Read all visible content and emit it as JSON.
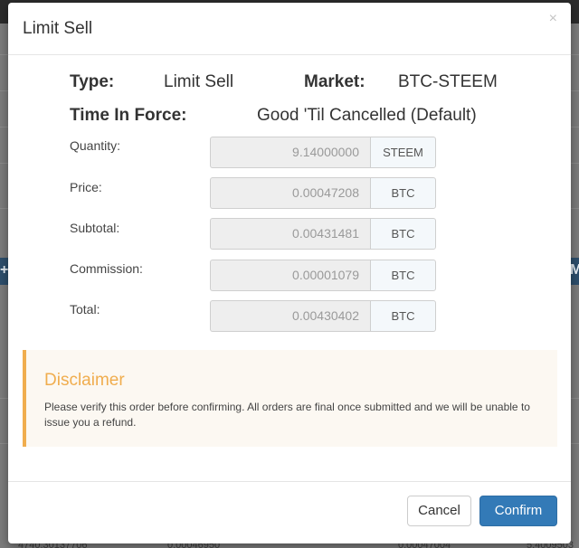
{
  "modal": {
    "title": "Limit Sell",
    "close_glyph": "×"
  },
  "summary": {
    "type_label": "Type:",
    "type_value": "Limit Sell",
    "market_label": "Market:",
    "market_value": "BTC-STEEM",
    "tif_label": "Time In Force:",
    "tif_value": "Good 'Til Cancelled (Default)"
  },
  "fields": [
    {
      "label": "Quantity:",
      "value": "9.14000000",
      "unit": "STEEM"
    },
    {
      "label": "Price:",
      "value": "0.00047208",
      "unit": "BTC"
    },
    {
      "label": "Subtotal:",
      "value": "0.00431481",
      "unit": "BTC"
    },
    {
      "label": "Commission:",
      "value": "0.00001079",
      "unit": "BTC"
    },
    {
      "label": "Total:",
      "value": "0.00430402",
      "unit": "BTC"
    }
  ],
  "disclaimer": {
    "title": "Disclaimer",
    "text": "Please verify this order before confirming. All orders are final once submitted and we will be unable to issue you a refund."
  },
  "buttons": {
    "cancel": "Cancel",
    "confirm": "Confirm"
  },
  "background": {
    "bottom_row": [
      "4740.30137706",
      "0.00046950",
      "0.00047004",
      "5.4009503"
    ],
    "colors": {
      "accent": "#337ab7",
      "warning": "#f0ad4e"
    }
  }
}
